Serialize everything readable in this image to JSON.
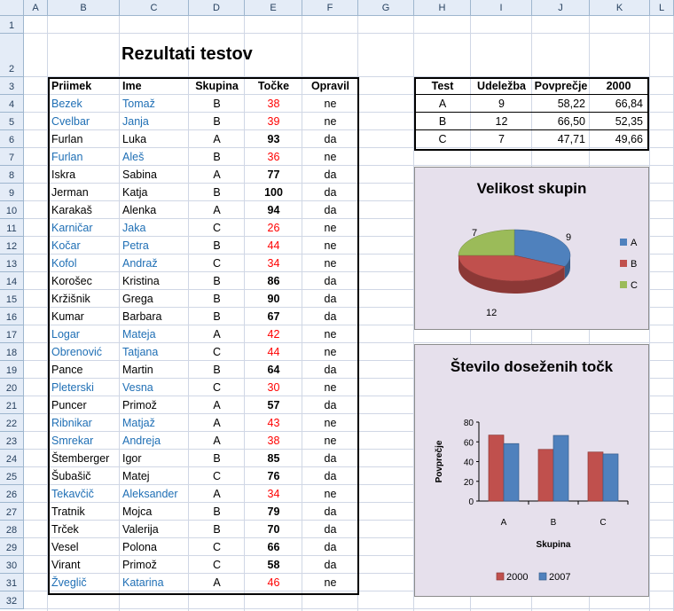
{
  "columns": [
    "A",
    "B",
    "C",
    "D",
    "E",
    "F",
    "G",
    "H",
    "I",
    "J",
    "K",
    "L"
  ],
  "rows": [
    "1",
    "2",
    "3",
    "4",
    "5",
    "6",
    "7",
    "8",
    "9",
    "10",
    "11",
    "12",
    "13",
    "14",
    "15",
    "16",
    "17",
    "18",
    "19",
    "20",
    "21",
    "22",
    "23",
    "24",
    "25",
    "26",
    "27",
    "28",
    "29",
    "30",
    "31",
    "32"
  ],
  "sheet_title": "Rezultati testov",
  "main_table": {
    "headers": [
      "Priimek",
      "Ime",
      "Skupina",
      "Točke",
      "Opravil"
    ],
    "rows": [
      {
        "surname": "Bezek",
        "name": "Tomaž",
        "group": "B",
        "points": "38",
        "passed": "ne"
      },
      {
        "surname": "Cvelbar",
        "name": "Janja",
        "group": "B",
        "points": "39",
        "passed": "ne"
      },
      {
        "surname": "Furlan",
        "name": "Luka",
        "group": "A",
        "points": "93",
        "passed": "da"
      },
      {
        "surname": "Furlan",
        "name": "Aleš",
        "group": "B",
        "points": "36",
        "passed": "ne"
      },
      {
        "surname": "Iskra",
        "name": "Sabina",
        "group": "A",
        "points": "77",
        "passed": "da"
      },
      {
        "surname": "Jerman",
        "name": "Katja",
        "group": "B",
        "points": "100",
        "passed": "da"
      },
      {
        "surname": "Karakaš",
        "name": "Alenka",
        "group": "A",
        "points": "94",
        "passed": "da"
      },
      {
        "surname": "Karničar",
        "name": "Jaka",
        "group": "C",
        "points": "26",
        "passed": "ne"
      },
      {
        "surname": "Kočar",
        "name": "Petra",
        "group": "B",
        "points": "44",
        "passed": "ne"
      },
      {
        "surname": "Kofol",
        "name": "Andraž",
        "group": "C",
        "points": "34",
        "passed": "ne"
      },
      {
        "surname": "Korošec",
        "name": "Kristina",
        "group": "B",
        "points": "86",
        "passed": "da"
      },
      {
        "surname": "Kržišnik",
        "name": "Grega",
        "group": "B",
        "points": "90",
        "passed": "da"
      },
      {
        "surname": "Kumar",
        "name": "Barbara",
        "group": "B",
        "points": "67",
        "passed": "da"
      },
      {
        "surname": "Logar",
        "name": "Mateja",
        "group": "A",
        "points": "42",
        "passed": "ne"
      },
      {
        "surname": "Obrenović",
        "name": "Tatjana",
        "group": "C",
        "points": "44",
        "passed": "ne"
      },
      {
        "surname": "Pance",
        "name": "Martin",
        "group": "B",
        "points": "64",
        "passed": "da"
      },
      {
        "surname": "Pleterski",
        "name": "Vesna",
        "group": "C",
        "points": "30",
        "passed": "ne"
      },
      {
        "surname": "Puncer",
        "name": "Primož",
        "group": "A",
        "points": "57",
        "passed": "da"
      },
      {
        "surname": "Ribnikar",
        "name": "Matjaž",
        "group": "A",
        "points": "43",
        "passed": "ne"
      },
      {
        "surname": "Smrekar",
        "name": "Andreja",
        "group": "A",
        "points": "38",
        "passed": "ne"
      },
      {
        "surname": "Štemberger",
        "name": "Igor",
        "group": "B",
        "points": "85",
        "passed": "da"
      },
      {
        "surname": "Šubašič",
        "name": "Matej",
        "group": "C",
        "points": "76",
        "passed": "da"
      },
      {
        "surname": "Tekavčič",
        "name": "Aleksander",
        "group": "A",
        "points": "34",
        "passed": "ne"
      },
      {
        "surname": "Tratnik",
        "name": "Mojca",
        "group": "B",
        "points": "79",
        "passed": "da"
      },
      {
        "surname": "Trček",
        "name": "Valerija",
        "group": "B",
        "points": "70",
        "passed": "da"
      },
      {
        "surname": "Vesel",
        "name": "Polona",
        "group": "C",
        "points": "66",
        "passed": "da"
      },
      {
        "surname": "Virant",
        "name": "Primož",
        "group": "C",
        "points": "58",
        "passed": "da"
      },
      {
        "surname": "Žveglič",
        "name": "Katarina",
        "group": "A",
        "points": "46",
        "passed": "ne"
      }
    ]
  },
  "summary_table": {
    "headers": [
      "Test",
      "Udeležba",
      "Povprečje",
      "2000"
    ],
    "rows": [
      {
        "test": "A",
        "count": "9",
        "avg": "58,22",
        "y2000": "66,84"
      },
      {
        "test": "B",
        "count": "12",
        "avg": "66,50",
        "y2000": "52,35"
      },
      {
        "test": "C",
        "count": "7",
        "avg": "47,71",
        "y2000": "49,66"
      }
    ]
  },
  "colors": {
    "A": "#4f81bd",
    "B": "#c0504d",
    "C": "#9bbb59",
    "chart_bg": "#e6e0ec",
    "fail_text": "#ff0000",
    "fail_name": "#1f6fb5"
  },
  "chart_data": [
    {
      "type": "pie",
      "title": "Velikost skupin",
      "categories": [
        "A",
        "B",
        "C"
      ],
      "values": [
        9,
        12,
        7
      ],
      "legend": "right"
    },
    {
      "type": "bar",
      "title": "Število doseženih točk",
      "xlabel": "Skupina",
      "ylabel": "Povprečje",
      "categories": [
        "A",
        "B",
        "C"
      ],
      "series": [
        {
          "name": "2000",
          "values": [
            66.84,
            52.35,
            49.66
          ]
        },
        {
          "name": "2007",
          "values": [
            58.22,
            66.5,
            47.71
          ]
        }
      ],
      "ylim": [
        0,
        80
      ],
      "yticks": [
        "0",
        "20",
        "40",
        "60",
        "80"
      ],
      "legend": "bottom"
    }
  ]
}
